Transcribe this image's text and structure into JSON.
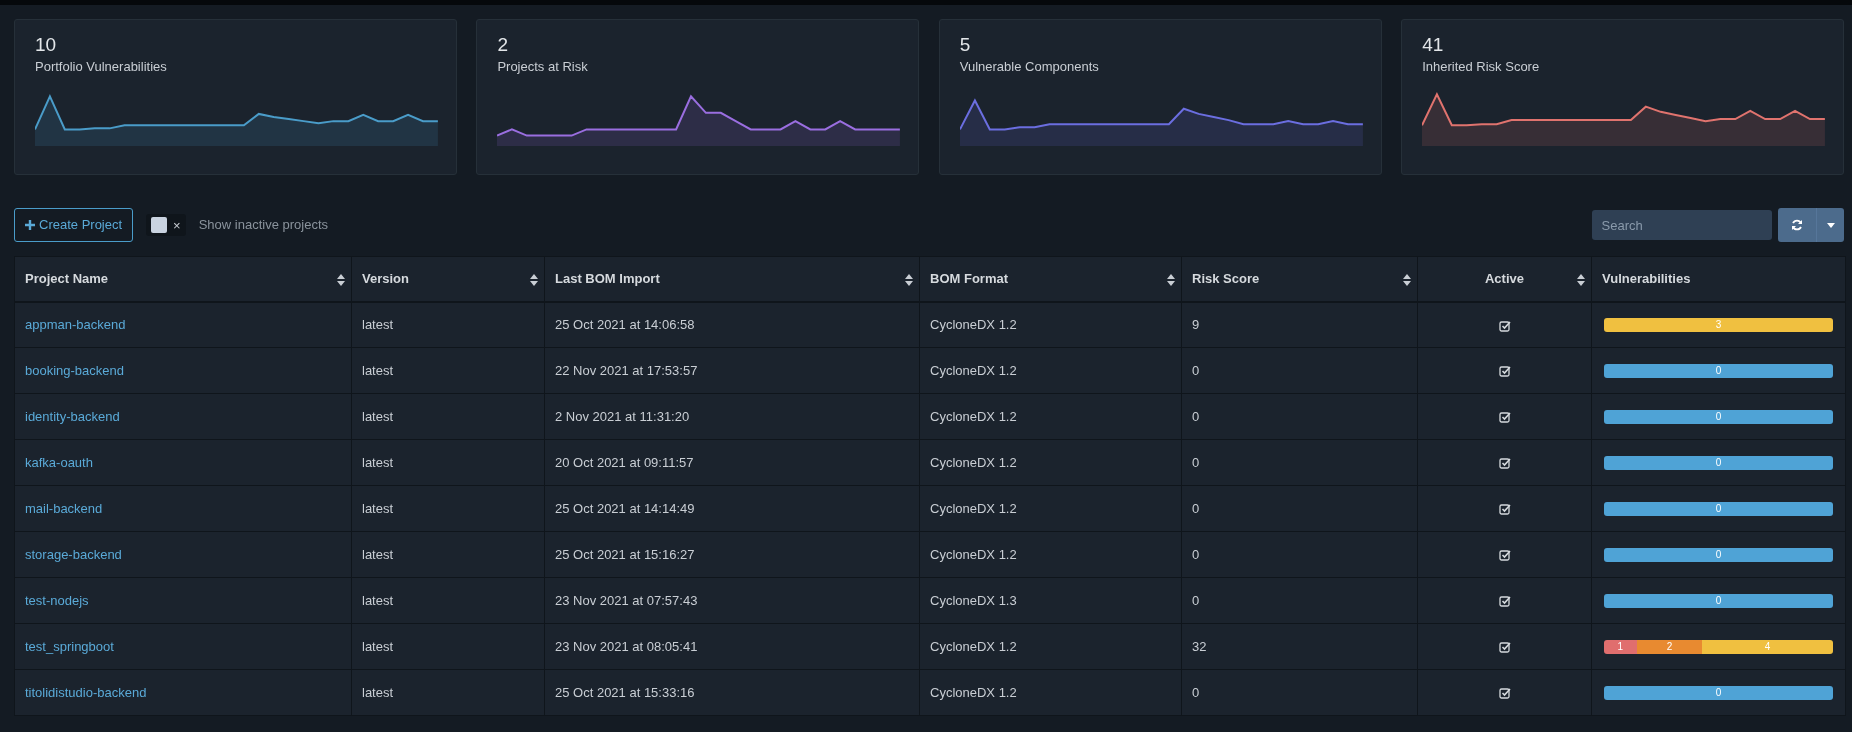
{
  "metrics": [
    {
      "value": "10",
      "label": "Portfolio Vulnerabilities",
      "color": "#4a9cc9"
    },
    {
      "value": "2",
      "label": "Projects at Risk",
      "color": "#9a6ee0"
    },
    {
      "value": "5",
      "label": "Vulnerable Components",
      "color": "#6b6ee0"
    },
    {
      "value": "41",
      "label": "Inherited Risk Score",
      "color": "#e0736e"
    }
  ],
  "toolbar": {
    "create_button": "Create Project",
    "toggle": {
      "symbol": "×",
      "checked": false,
      "label": "Show inactive projects"
    },
    "search": {
      "placeholder": "Search"
    }
  },
  "table": {
    "columns": [
      {
        "label": "Project Name",
        "sortable": true
      },
      {
        "label": "Version",
        "sortable": true
      },
      {
        "label": "Last BOM Import",
        "sortable": true
      },
      {
        "label": "BOM Format",
        "sortable": true
      },
      {
        "label": "Risk Score",
        "sortable": true
      },
      {
        "label": "Active",
        "sortable": true
      },
      {
        "label": "Vulnerabilities",
        "sortable": false
      }
    ],
    "rows": [
      {
        "name": "appman-backend",
        "version": "latest",
        "last_import": "25 Oct 2021 at 14:06:58",
        "format": "CycloneDX 1.2",
        "risk": "9",
        "active": true,
        "vulns": [
          {
            "count": "3",
            "color": "#f0c040"
          }
        ]
      },
      {
        "name": "booking-backend",
        "version": "latest",
        "last_import": "22 Nov 2021 at 17:53:57",
        "format": "CycloneDX 1.2",
        "risk": "0",
        "active": true,
        "vulns": [
          {
            "count": "0",
            "color": "#4fa3d6"
          }
        ]
      },
      {
        "name": "identity-backend",
        "version": "latest",
        "last_import": "2 Nov 2021 at 11:31:20",
        "format": "CycloneDX 1.2",
        "risk": "0",
        "active": true,
        "vulns": [
          {
            "count": "0",
            "color": "#4fa3d6"
          }
        ]
      },
      {
        "name": "kafka-oauth",
        "version": "latest",
        "last_import": "20 Oct 2021 at 09:11:57",
        "format": "CycloneDX 1.2",
        "risk": "0",
        "active": true,
        "vulns": [
          {
            "count": "0",
            "color": "#4fa3d6"
          }
        ]
      },
      {
        "name": "mail-backend",
        "version": "latest",
        "last_import": "25 Oct 2021 at 14:14:49",
        "format": "CycloneDX 1.2",
        "risk": "0",
        "active": true,
        "vulns": [
          {
            "count": "0",
            "color": "#4fa3d6"
          }
        ]
      },
      {
        "name": "storage-backend",
        "version": "latest",
        "last_import": "25 Oct 2021 at 15:16:27",
        "format": "CycloneDX 1.2",
        "risk": "0",
        "active": true,
        "vulns": [
          {
            "count": "0",
            "color": "#4fa3d6"
          }
        ]
      },
      {
        "name": "test-nodejs",
        "version": "latest",
        "last_import": "23 Nov 2021 at 07:57:43",
        "format": "CycloneDX 1.3",
        "risk": "0",
        "active": true,
        "vulns": [
          {
            "count": "0",
            "color": "#4fa3d6"
          }
        ]
      },
      {
        "name": "test_springboot",
        "version": "latest",
        "last_import": "23 Nov 2021 at 08:05:41",
        "format": "CycloneDX 1.2",
        "risk": "32",
        "active": true,
        "vulns": [
          {
            "count": "1",
            "color": "#e06e6e"
          },
          {
            "count": "2",
            "color": "#e88a30"
          },
          {
            "count": "4",
            "color": "#f0c040"
          }
        ]
      },
      {
        "name": "titolidistudio-backend",
        "version": "latest",
        "last_import": "25 Oct 2021 at 15:33:16",
        "format": "CycloneDX 1.2",
        "risk": "0",
        "active": true,
        "vulns": [
          {
            "count": "0",
            "color": "#4fa3d6"
          }
        ]
      }
    ]
  }
}
